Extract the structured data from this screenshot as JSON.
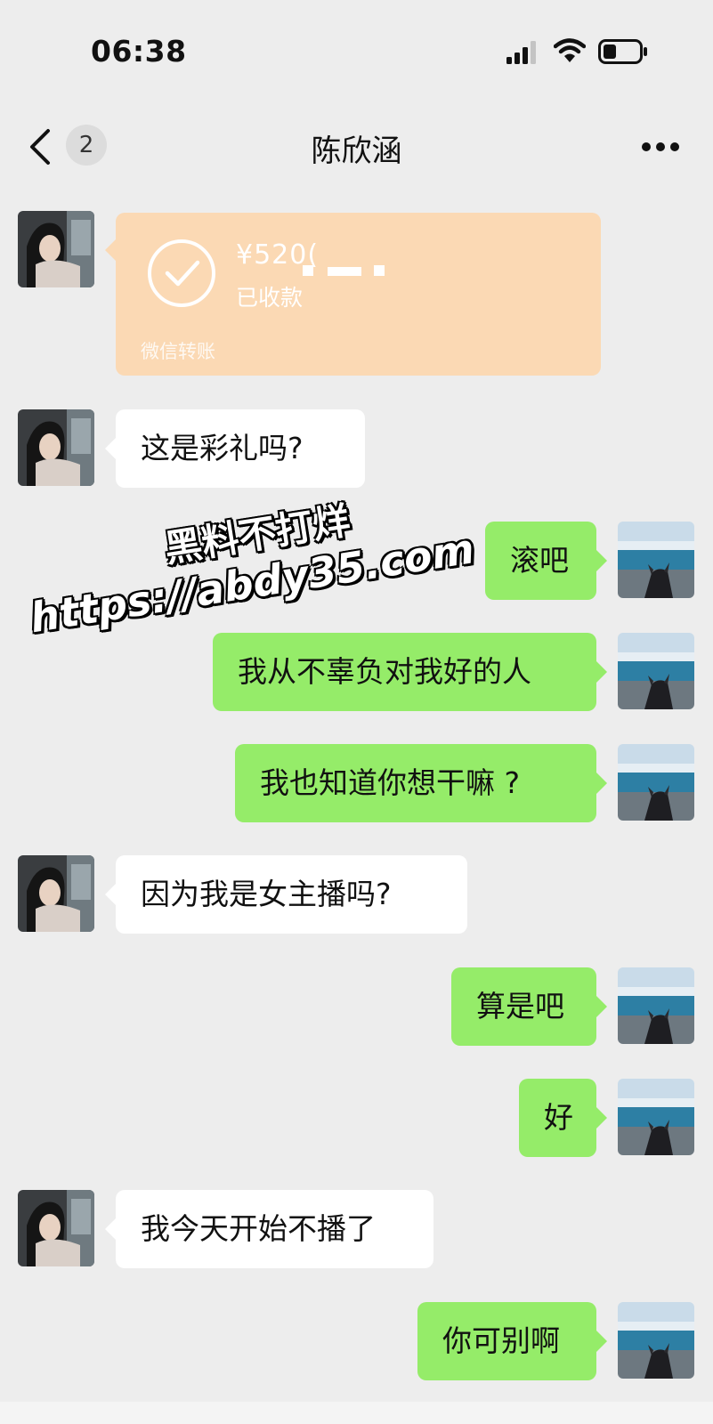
{
  "status_bar": {
    "time": "06:38",
    "icons": [
      "signal-icon",
      "wifi-icon",
      "battery-icon"
    ]
  },
  "nav": {
    "title": "陈欣涵",
    "unread_count": "2",
    "icons": [
      "back-icon",
      "more-icon"
    ]
  },
  "colors": {
    "background": "#ededed",
    "outgoing_bubble": "#95ec69",
    "incoming_bubble": "#ffffff",
    "transfer_card": "#fbd9b4"
  },
  "transfer": {
    "amount": "¥520(",
    "status": "已收款",
    "label": "微信转账"
  },
  "messages": [
    {
      "sender": "contact",
      "text": "这是彩礼吗?"
    },
    {
      "sender": "me",
      "text": "滚吧"
    },
    {
      "sender": "me",
      "text": "我从不辜负对我好的人"
    },
    {
      "sender": "me",
      "text": "我也知道你想干嘛 ?"
    },
    {
      "sender": "contact",
      "text": "因为我是女主播吗?"
    },
    {
      "sender": "me",
      "text": "算是吧"
    },
    {
      "sender": "me",
      "text": "好"
    },
    {
      "sender": "contact",
      "text": "我今天开始不播了"
    },
    {
      "sender": "me",
      "text": "你可别啊"
    }
  ],
  "watermark": {
    "line1": "黑料不打烊",
    "line2": "https://abdy35.com"
  }
}
